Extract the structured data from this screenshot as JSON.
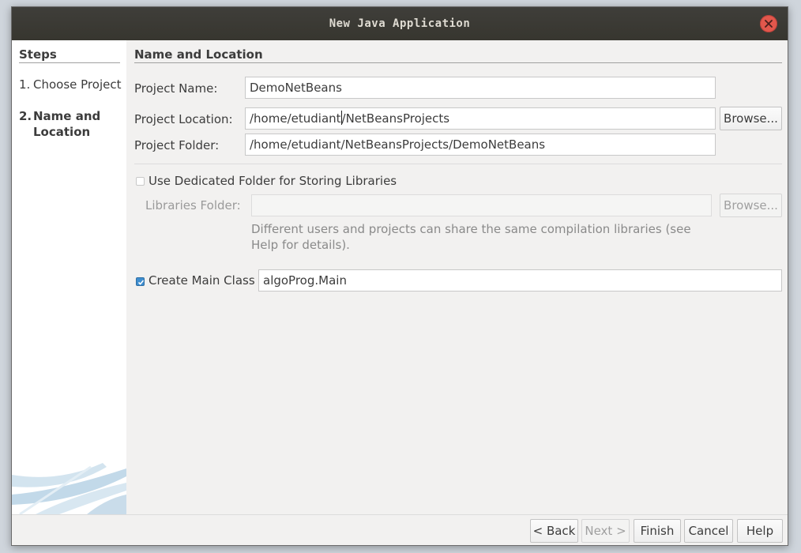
{
  "window": {
    "title": "New Java Application"
  },
  "steps": {
    "title": "Steps",
    "items": [
      {
        "number": "1.",
        "label": "Choose Project",
        "current": false
      },
      {
        "number": "2.",
        "label": "Name and Location",
        "current": true
      }
    ]
  },
  "panel": {
    "title": "Name and Location",
    "project_name": {
      "label": "Project Name:",
      "value": "DemoNetBeans"
    },
    "project_location": {
      "label": "Project Location:",
      "value_before_caret": "/home/etudiant",
      "value_after_caret": "/NetBeansProjects",
      "browse_label": "Browse..."
    },
    "project_folder": {
      "label": "Project Folder:",
      "value": "/home/etudiant/NetBeansProjects/DemoNetBeans"
    },
    "dedicated_folder": {
      "label": "Use Dedicated Folder for Storing Libraries",
      "checked": false
    },
    "libraries_folder": {
      "label": "Libraries Folder:",
      "value": "",
      "browse_label": "Browse..."
    },
    "hint": "Different users and projects can share the same compilation libraries (see Help for details).",
    "main_class": {
      "label": "Create Main Class",
      "checked": true,
      "value": "algoProg.Main"
    }
  },
  "buttons": {
    "back": "< Back",
    "next": "Next >",
    "finish": "Finish",
    "cancel": "Cancel",
    "help": "Help"
  },
  "colors": {
    "titlebar": "#3f3e3a",
    "close": "#e2574c",
    "checkbox_checked": "#3e8ed0"
  }
}
